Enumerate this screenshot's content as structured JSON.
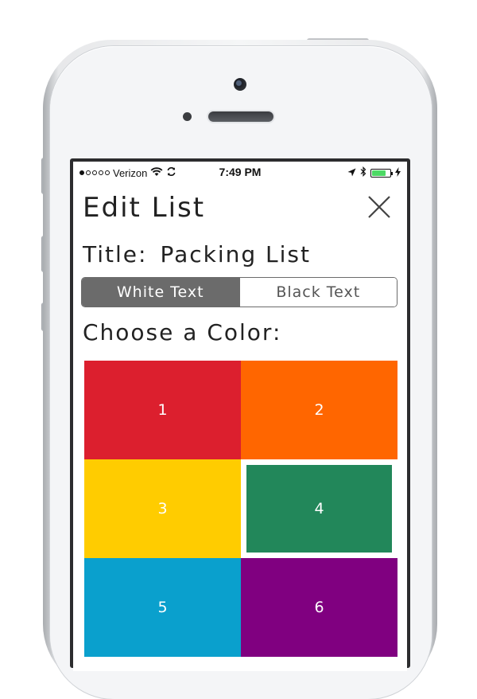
{
  "status_bar": {
    "carrier": "Verizon",
    "time": "7:49 PM",
    "signal_bars_filled": 1,
    "signal_bars_total": 5,
    "battery_level": 0.75
  },
  "header": {
    "title": "Edit List",
    "close_icon": "close-x-icon"
  },
  "list": {
    "title_label": "Title:",
    "title_value": "Packing List"
  },
  "text_color_toggle": {
    "options": [
      "White Text",
      "Black Text"
    ],
    "selected": "White Text"
  },
  "color_picker": {
    "heading": "Choose a Color:",
    "swatches": [
      {
        "label": "1",
        "color": "#dc1f2e"
      },
      {
        "label": "2",
        "color": "#ff6600"
      },
      {
        "label": "3",
        "color": "#ffcc00"
      },
      {
        "label": "4",
        "color": "#22875a"
      },
      {
        "label": "5",
        "color": "#0aa0cd"
      },
      {
        "label": "6",
        "color": "#800080"
      }
    ],
    "selected": "4"
  },
  "colors": {
    "segment_active": "#6b6b6b",
    "battery_fill": "#4cd964"
  }
}
